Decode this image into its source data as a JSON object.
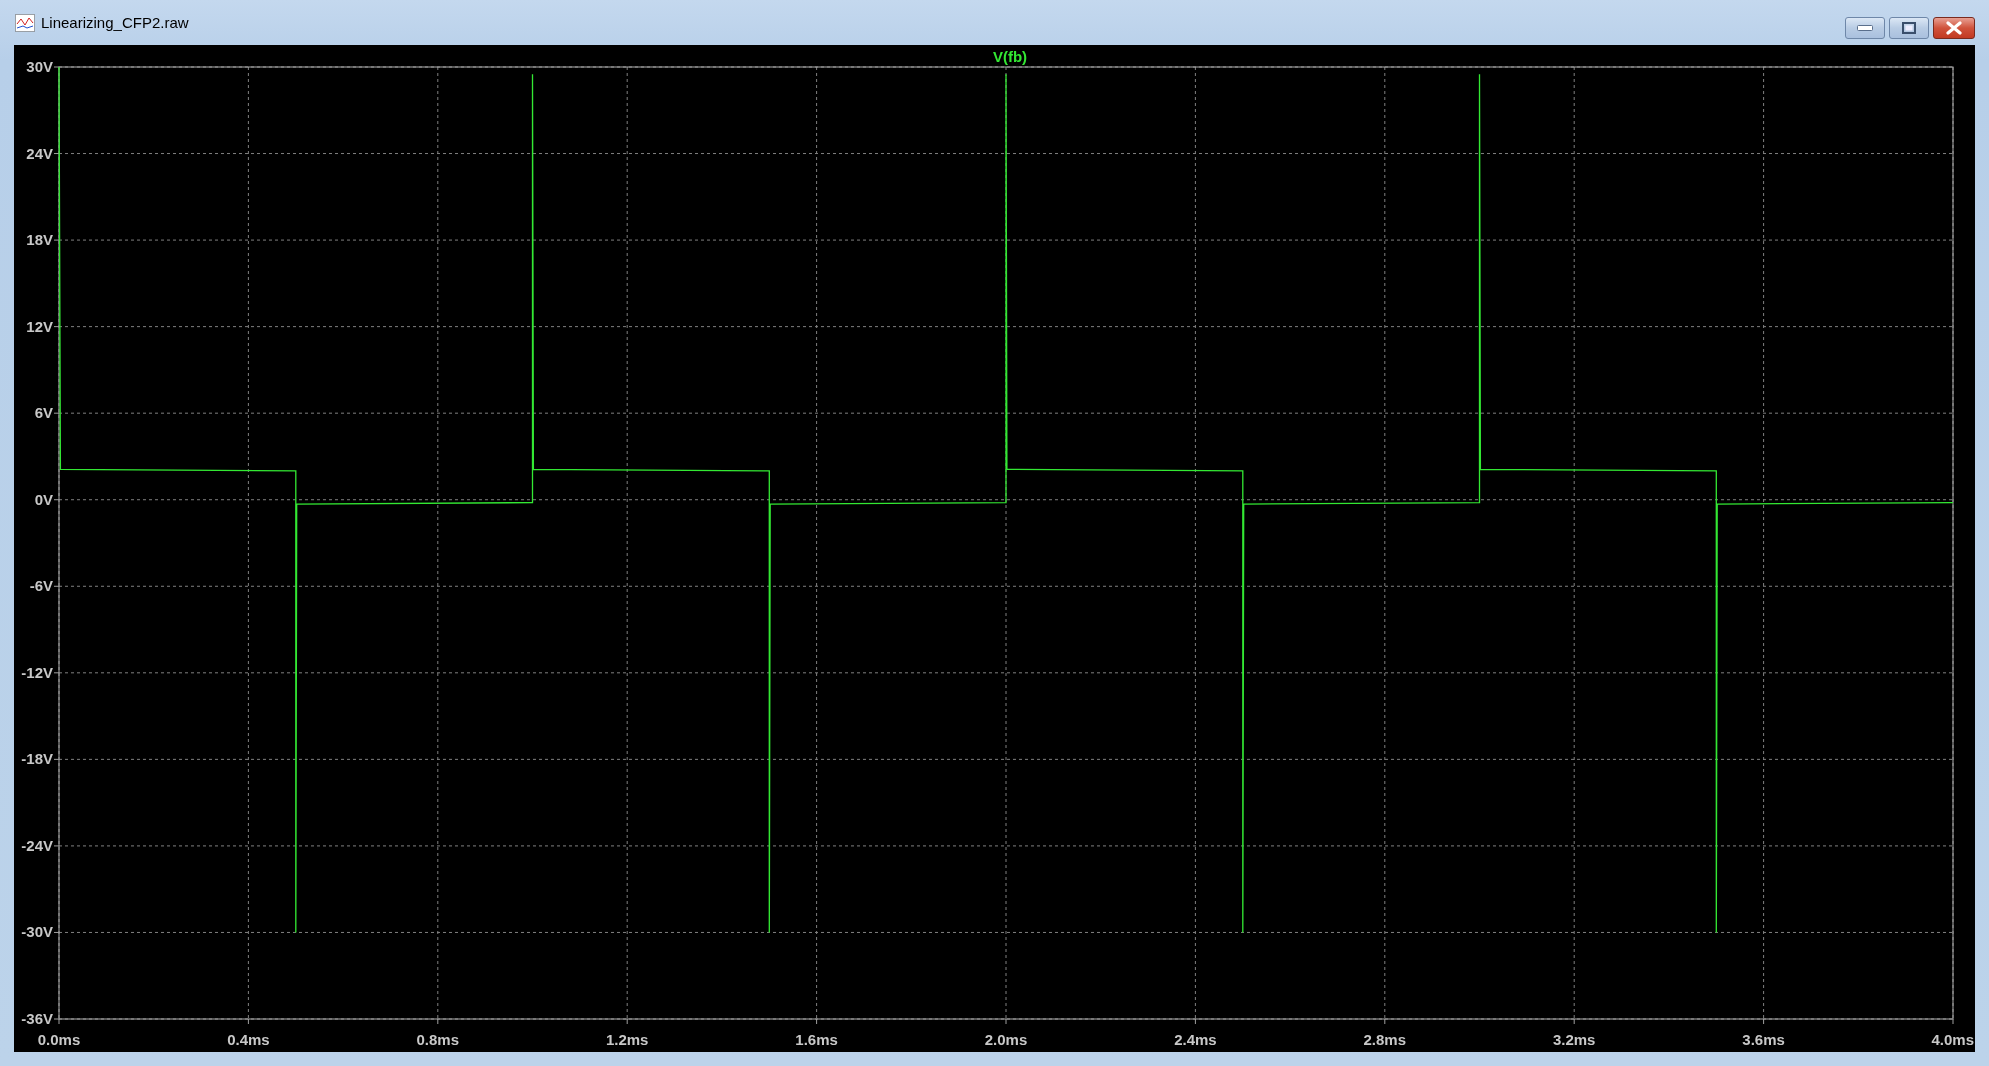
{
  "window": {
    "title": "Linearizing_CFP2.raw"
  },
  "plot": {
    "chart_data": {
      "type": "line",
      "grid": true,
      "xlim": [
        0,
        4
      ],
      "ylim": [
        -36,
        30
      ],
      "xticks": [
        {
          "value": 0,
          "label": "0.0ms"
        },
        {
          "value": 0.4,
          "label": "0.4ms"
        },
        {
          "value": 0.8,
          "label": "0.8ms"
        },
        {
          "value": 1.2,
          "label": "1.2ms"
        },
        {
          "value": 1.6,
          "label": "1.6ms"
        },
        {
          "value": 2.0,
          "label": "2.0ms"
        },
        {
          "value": 2.4,
          "label": "2.4ms"
        },
        {
          "value": 2.8,
          "label": "2.8ms"
        },
        {
          "value": 3.2,
          "label": "3.2ms"
        },
        {
          "value": 3.6,
          "label": "3.6ms"
        },
        {
          "value": 4.0,
          "label": "4.0ms"
        }
      ],
      "yticks": [
        {
          "value": 30,
          "label": "30V"
        },
        {
          "value": 24,
          "label": "24V"
        },
        {
          "value": 18,
          "label": "18V"
        },
        {
          "value": 12,
          "label": "12V"
        },
        {
          "value": 6,
          "label": "6V"
        },
        {
          "value": 0,
          "label": "0V"
        },
        {
          "value": -6,
          "label": "-6V"
        },
        {
          "value": -12,
          "label": "-12V"
        },
        {
          "value": -18,
          "label": "-18V"
        },
        {
          "value": -24,
          "label": "-24V"
        },
        {
          "value": -30,
          "label": "-30V"
        },
        {
          "value": -36,
          "label": "-36V"
        }
      ],
      "x": [
        0,
        0.003,
        0.5,
        0.5,
        0.502,
        1.0,
        1.0,
        1.002,
        1.5,
        1.5,
        1.502,
        2.0,
        2.0,
        2.002,
        2.5,
        2.5,
        2.502,
        3.0,
        3.0,
        3.002,
        3.5,
        3.5,
        3.502,
        4.0
      ],
      "series": [
        {
          "name": "V(fb)",
          "color": "#33e833",
          "values": [
            30,
            2.1,
            2.0,
            -30,
            -0.3,
            -0.2,
            29.5,
            2.1,
            2.0,
            -30,
            -0.3,
            -0.2,
            29.5,
            2.1,
            2.0,
            -30,
            -0.3,
            -0.2,
            29.5,
            2.1,
            2.0,
            -30,
            -0.3,
            -0.2
          ]
        }
      ]
    }
  }
}
